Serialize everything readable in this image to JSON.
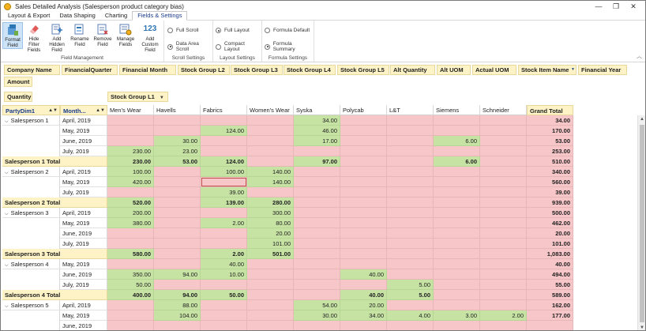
{
  "window": {
    "title": "Sales Detailed Analysis (Salesperson product category bias)",
    "min_glyph": "—",
    "max_glyph": "❐",
    "close_glyph": "✕"
  },
  "ribbon_tabs": [
    "Layout & Export",
    "Data Shaping",
    "Charting",
    "Fields & Settings"
  ],
  "active_ribbon_tab": "Fields & Settings",
  "ribbon": {
    "field_management": {
      "label": "Field Management",
      "buttons": [
        {
          "label": "Format Field",
          "icon": "format-field-icon"
        },
        {
          "label": "Hide Filter Fields",
          "icon": "eraser-icon"
        },
        {
          "label": "Add Hidden Field",
          "icon": "add-field-icon"
        },
        {
          "label": "Rename Field",
          "icon": "rename-field-icon"
        },
        {
          "label": "Remove Field",
          "icon": "remove-field-icon"
        },
        {
          "label": "Manage Fields",
          "icon": "manage-fields-icon"
        },
        {
          "label": "Add Custom Field",
          "icon": "custom-field-icon",
          "glyph": "123"
        }
      ]
    },
    "scroll_settings": {
      "label": "Scroll Settings",
      "options": [
        {
          "label": "Full Scroll",
          "selected": false
        },
        {
          "label": "Data Area Scroll",
          "selected": true
        }
      ]
    },
    "layout_settings": {
      "label": "Layout Settings",
      "options": [
        {
          "label": "Full Layout",
          "selected": true
        },
        {
          "label": "Compact Layout",
          "selected": false
        }
      ]
    },
    "formula_settings": {
      "label": "Formula Settings",
      "options": [
        {
          "label": "Formula Default",
          "selected": false
        },
        {
          "label": "Formula Summary",
          "selected": true
        }
      ]
    }
  },
  "filter_fields": [
    "Company Name",
    "FinancialQuarter",
    "Financial Month",
    "Stock Group L2",
    "Stock Group L3",
    "Stock Group L4",
    "Stock Group L5",
    "Alt Quantity",
    "Alt UOM",
    "Actual UOM",
    "Stock Item Name",
    "Financial Year",
    "Amount"
  ],
  "data_field": "Quantity",
  "column_field": "Stock Group L1",
  "row_fields": [
    "PartyDim1",
    "Month..."
  ],
  "columns": [
    "Men's Wear",
    "Havells",
    "Fabrics",
    "Women's Wear",
    "Syska",
    "Polycab",
    "L&T",
    "Siemens",
    "Schneider"
  ],
  "grand_total_label": "Grand Total",
  "colors": {
    "low": "#f7c6c8",
    "high": "#c6e3a4",
    "field_chip": "#fdf3c6"
  },
  "rows": [
    {
      "type": "data",
      "group": "Salesperson 1",
      "month": "April, 2019",
      "values": [
        "",
        "",
        "",
        "",
        "34.00",
        "",
        "",
        "",
        ""
      ],
      "total": "34.00"
    },
    {
      "type": "data",
      "group": "",
      "month": "May, 2019",
      "values": [
        "",
        "",
        "124.00",
        "",
        "46.00",
        "",
        "",
        "",
        ""
      ],
      "total": "170.00"
    },
    {
      "type": "data",
      "group": "",
      "month": "June, 2019",
      "values": [
        "",
        "30.00",
        "",
        "",
        "17.00",
        "",
        "",
        "6.00",
        ""
      ],
      "total": "53.00"
    },
    {
      "type": "data",
      "group": "",
      "month": "July, 2019",
      "values": [
        "230.00",
        "23.00",
        "",
        "",
        "",
        "",
        "",
        "",
        ""
      ],
      "total": "253.00"
    },
    {
      "type": "total",
      "label": "Salesperson 1 Total",
      "values": [
        "230.00",
        "53.00",
        "124.00",
        "",
        "97.00",
        "",
        "",
        "6.00",
        ""
      ],
      "total": "510.00"
    },
    {
      "type": "data",
      "group": "Salesperson 2",
      "month": "April, 2019",
      "values": [
        "100.00",
        "",
        "100.00",
        "140.00",
        "",
        "",
        "",
        "",
        ""
      ],
      "total": "340.00"
    },
    {
      "type": "data",
      "group": "",
      "month": "May, 2019",
      "values": [
        "420.00",
        "",
        "",
        "140.00",
        "",
        "",
        "",
        "",
        ""
      ],
      "total": "560.00",
      "selected_col": 2
    },
    {
      "type": "data",
      "group": "",
      "month": "July, 2019",
      "values": [
        "",
        "",
        "39.00",
        "",
        "",
        "",
        "",
        "",
        ""
      ],
      "total": "39.00"
    },
    {
      "type": "total",
      "label": "Salesperson 2 Total",
      "values": [
        "520.00",
        "",
        "139.00",
        "280.00",
        "",
        "",
        "",
        "",
        ""
      ],
      "total": "939.00"
    },
    {
      "type": "data",
      "group": "Salesperson 3",
      "month": "April, 2019",
      "values": [
        "200.00",
        "",
        "",
        "300.00",
        "",
        "",
        "",
        "",
        ""
      ],
      "total": "500.00"
    },
    {
      "type": "data",
      "group": "",
      "month": "May, 2019",
      "values": [
        "380.00",
        "",
        "2.00",
        "80.00",
        "",
        "",
        "",
        "",
        ""
      ],
      "total": "462.00"
    },
    {
      "type": "data",
      "group": "",
      "month": "June, 2019",
      "values": [
        "",
        "",
        "",
        "20.00",
        "",
        "",
        "",
        "",
        ""
      ],
      "total": "20.00"
    },
    {
      "type": "data",
      "group": "",
      "month": "July, 2019",
      "values": [
        "",
        "",
        "",
        "101.00",
        "",
        "",
        "",
        "",
        ""
      ],
      "total": "101.00"
    },
    {
      "type": "total",
      "label": "Salesperson 3 Total",
      "values": [
        "580.00",
        "",
        "2.00",
        "501.00",
        "",
        "",
        "",
        "",
        ""
      ],
      "total": "1,083.00"
    },
    {
      "type": "data",
      "group": "Salesperson 4",
      "month": "May, 2019",
      "values": [
        "",
        "",
        "40.00",
        "",
        "",
        "",
        "",
        "",
        ""
      ],
      "total": "40.00"
    },
    {
      "type": "data",
      "group": "",
      "month": "June, 2019",
      "values": [
        "350.00",
        "94.00",
        "10.00",
        "",
        "",
        "40.00",
        "",
        "",
        ""
      ],
      "total": "494.00"
    },
    {
      "type": "data",
      "group": "",
      "month": "July, 2019",
      "values": [
        "50.00",
        "",
        "",
        "",
        "",
        "",
        "5.00",
        "",
        ""
      ],
      "total": "55.00"
    },
    {
      "type": "total",
      "label": "Salesperson 4 Total",
      "values": [
        "400.00",
        "94.00",
        "50.00",
        "",
        "",
        "40.00",
        "5.00",
        "",
        ""
      ],
      "total": "589.00"
    },
    {
      "type": "data",
      "group": "Salesperson 5",
      "month": "April, 2019",
      "values": [
        "",
        "88.00",
        "",
        "",
        "54.00",
        "20.00",
        "",
        "",
        ""
      ],
      "total": "162.00"
    },
    {
      "type": "data",
      "group": "",
      "month": "May, 2019",
      "values": [
        "",
        "104.00",
        "",
        "",
        "30.00",
        "34.00",
        "4.00",
        "3.00",
        "2.00"
      ],
      "total": "177.00"
    },
    {
      "type": "data",
      "group": "",
      "month": "June, 2019",
      "values": [
        "",
        "",
        "",
        "",
        "",
        "",
        "",
        "",
        ""
      ],
      "total": ""
    }
  ]
}
